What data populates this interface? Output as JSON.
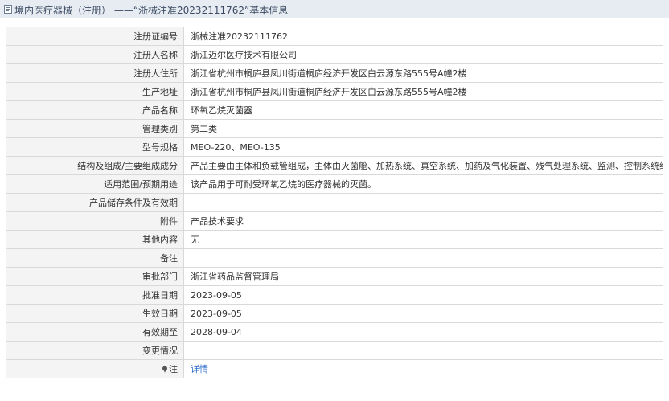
{
  "header": {
    "title": "境内医疗器械（注册） ——“浙械注准20232111762”基本信息"
  },
  "rows": [
    {
      "label": "注册证编号",
      "value": "浙械注准20232111762"
    },
    {
      "label": "注册人名称",
      "value": "浙江迈尔医疗技术有限公司"
    },
    {
      "label": "注册人住所",
      "value": "浙江省杭州市桐庐县凤川街道桐庐经济开发区白云源东路555号A幢2楼"
    },
    {
      "label": "生产地址",
      "value": "浙江省杭州市桐庐县凤川街道桐庐经济开发区白云源东路555号A幢2楼"
    },
    {
      "label": "产品名称",
      "value": "环氧乙烷灭菌器"
    },
    {
      "label": "管理类别",
      "value": "第二类"
    },
    {
      "label": "型号规格",
      "value": "MEO-220、MEO-135"
    },
    {
      "label": "结构及组成/主要组成成分",
      "value": "产品主要由主体和负载管组成，主体由灭菌舱、加热系统、真空系统、加药及气化装置、残气处理系统、监测、控制系统组成。"
    },
    {
      "label": "适用范围/预期用途",
      "value": "该产品用于可耐受环氧乙烷的医疗器械的灭菌。"
    },
    {
      "label": "产品储存条件及有效期",
      "value": ""
    },
    {
      "label": "附件",
      "value": "产品技术要求"
    },
    {
      "label": "其他内容",
      "value": "无"
    },
    {
      "label": "备注",
      "value": ""
    },
    {
      "label": "审批部门",
      "value": "浙江省药品监督管理局"
    },
    {
      "label": "批准日期",
      "value": "2023-09-05"
    },
    {
      "label": "生效日期",
      "value": "2023-09-05"
    },
    {
      "label": "有效期至",
      "value": "2028-09-04"
    },
    {
      "label": "变更情况",
      "value": ""
    }
  ],
  "note_row": {
    "label": "注",
    "link": "详情",
    "icon": "pin-icon"
  },
  "colors": {
    "header_bg": "#e7ecf3",
    "label_bg": "#f4f4f4",
    "border": "#d9d9d9",
    "link": "#2a6cc9"
  }
}
